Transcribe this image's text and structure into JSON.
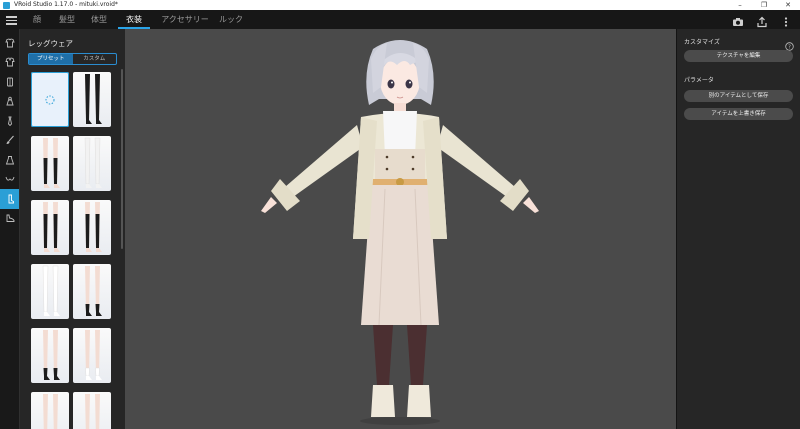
{
  "window": {
    "title": "VRoid Studio 1.17.0 - mituki.vroid*"
  },
  "menu": {
    "tabs": [
      {
        "label": "顔"
      },
      {
        "label": "髪型"
      },
      {
        "label": "体型"
      },
      {
        "label": "衣装"
      },
      {
        "label": "アクセサリー"
      },
      {
        "label": "ルック"
      }
    ],
    "active_tab": "衣装"
  },
  "rail": {
    "items": [
      "tshirt-icon",
      "shirt-icon",
      "outfit-icon",
      "dress-icon",
      "tie-icon",
      "brush-icon",
      "skirt-icon",
      "bra-icon",
      "legwear-icon",
      "shoe-icon"
    ],
    "active_index": 8
  },
  "left_panel": {
    "title": "レッグウェア",
    "toggle": {
      "preset": "プリセット",
      "custom": "カスタム",
      "selected": "プリセット"
    },
    "thumbnails": [
      {
        "name": "legwear-none",
        "selected": true,
        "checked": false
      },
      {
        "name": "legwear-black-tights",
        "selected": false,
        "checked": true
      },
      {
        "name": "legwear-black-knee-socks",
        "selected": false,
        "checked": true
      },
      {
        "name": "legwear-white-tights",
        "selected": false,
        "checked": true
      },
      {
        "name": "legwear-black-thigh-highs",
        "selected": false,
        "checked": true
      },
      {
        "name": "legwear-black-over-knee",
        "selected": false,
        "checked": true
      },
      {
        "name": "legwear-white-stockings",
        "selected": false,
        "checked": true
      },
      {
        "name": "legwear-black-ankle-socks",
        "selected": false,
        "checked": true
      },
      {
        "name": "legwear-black-short-socks",
        "selected": false,
        "checked": true
      },
      {
        "name": "legwear-white-short-socks",
        "selected": false,
        "checked": true
      },
      {
        "name": "legwear-white-socks-a",
        "selected": false,
        "checked": false
      },
      {
        "name": "legwear-white-socks-b",
        "selected": false,
        "checked": false
      }
    ]
  },
  "right_panel": {
    "customize_header": "カスタマイズ",
    "edit_texture_button": "テクスチャを編集",
    "parameter_header": "パラメータ",
    "save_as_new_button": "別のアイテムとして保存",
    "overwrite_button": "アイテムを上書き保存"
  },
  "colors": {
    "accent": "#2a9fd6",
    "viewport_bg": "#4a4a4a",
    "panel_bg": "#262626"
  }
}
